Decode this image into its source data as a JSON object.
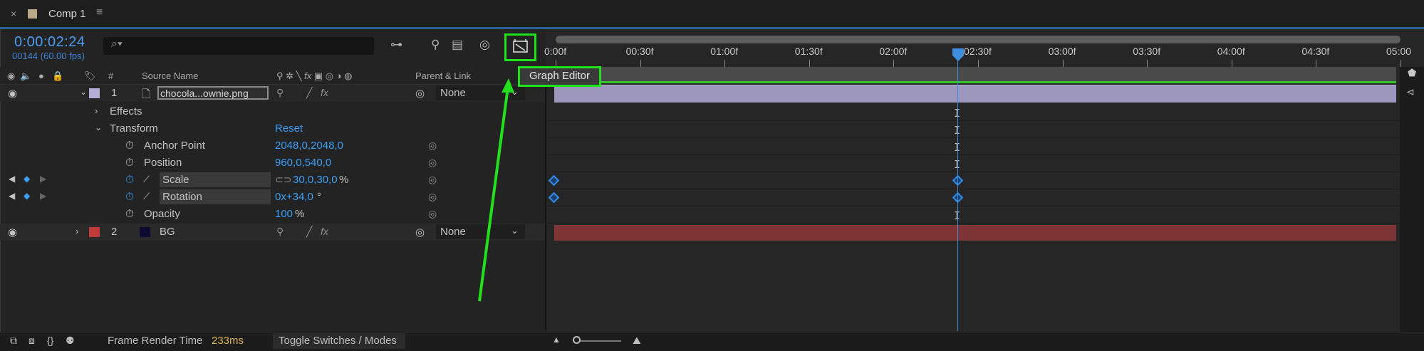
{
  "tab": {
    "close": "×",
    "title": "Comp 1",
    "menu": "≡"
  },
  "header": {
    "timecode": "0:00:02:24",
    "frames": "00144 (60.00 fps)",
    "search_placeholder": ""
  },
  "columns": {
    "source_name": "Source Name",
    "hash": "#",
    "parent_link": "Parent & Link",
    "fx_glyph": "fx"
  },
  "layers": [
    {
      "num": "1",
      "name": "chocola...ownie.png",
      "parent": "None",
      "label_color": "#b4aed6"
    },
    {
      "num": "2",
      "name": "BG",
      "parent": "None",
      "label_color": "#c03a3a"
    }
  ],
  "groups": {
    "effects": "Effects",
    "transform": "Transform",
    "reset": "Reset"
  },
  "properties": [
    {
      "name": "Anchor Point",
      "value": "2048,0,2048,0"
    },
    {
      "name": "Position",
      "value": "960,0,540,0"
    },
    {
      "name": "Scale",
      "value": "30,0,30,0",
      "unit": "%"
    },
    {
      "name": "Rotation",
      "value": "0x+34,0",
      "unit": "°"
    },
    {
      "name": "Opacity",
      "value": "100",
      "unit": "%"
    }
  ],
  "ruler": [
    "0:00f",
    "00:30f",
    "01:00f",
    "01:30f",
    "02:00f",
    "02:30f",
    "03:00f",
    "03:30f",
    "04:00f",
    "04:30f",
    "05:00"
  ],
  "tooltip": "Graph Editor",
  "footer": {
    "frame_render_label": "Frame Render Time",
    "frame_render_value": "233ms",
    "toggle": "Toggle Switches / Modes"
  },
  "colors": {
    "accent": "#3c9ef4",
    "highlight": "#22e01c",
    "layer1_bar": "#9e97bd",
    "layer2_bar": "#7e3535",
    "playhead": "#3f8ede"
  },
  "icons": [
    "close-icon",
    "menu-icon",
    "search-icon",
    "graph-editor-icon",
    "stopwatch-icon",
    "link-icon",
    "pickwhip-icon",
    "keyframe-icon",
    "eye-icon",
    "audio-icon",
    "lock-icon",
    "label-tag-icon",
    "zoom-mountain-icon"
  ]
}
